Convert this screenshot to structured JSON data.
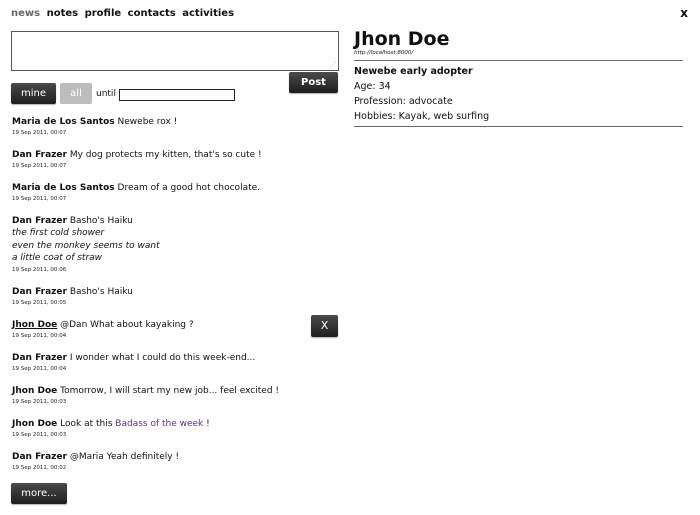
{
  "nav": {
    "items": [
      "news",
      "notes",
      "profile",
      "contacts",
      "activities"
    ],
    "close_label": "x"
  },
  "composer": {
    "value": "",
    "post_label": "Post"
  },
  "filters": {
    "mine_label": "mine",
    "all_label": "all",
    "until_label": "until",
    "until_value": ""
  },
  "feed": [
    {
      "author": "Maria de Los Santos",
      "text": "Newebe rox !",
      "time": "19 Sep 2011, 00:07"
    },
    {
      "author": "Dan Frazer",
      "text": "My dog protects my kitten, that's so cute !",
      "time": "19 Sep 2011, 00:07"
    },
    {
      "author": "Maria de Los Santos",
      "text": "Dream of a good hot chocolate.",
      "time": "19 Sep 2011, 00:07"
    },
    {
      "author": "Dan Frazer",
      "text": "Basho's Haiku",
      "verses": [
        "the first cold shower",
        "even the monkey seems to want",
        "a little coat of straw"
      ],
      "time": "19 Sep 2011, 00:06"
    },
    {
      "author": "Dan Frazer",
      "text": "Basho's Haiku",
      "time": "19 Sep 2011, 00:05"
    },
    {
      "author": "Jhon Doe",
      "text": "@Dan What about kayaking ?",
      "time": "19 Sep 2011, 00:04",
      "delete_label": "X"
    },
    {
      "author": "Dan Frazer",
      "text": "I wonder what I could do this week-end...",
      "time": "19 Sep 2011, 00:04"
    },
    {
      "author": "Jhon Doe",
      "text": "Tomorrow, I will start my new job... feel excited !",
      "time": "19 Sep 2011, 00:03"
    },
    {
      "author": "Jhon Doe",
      "text": "Look at this",
      "link_text": "Badass of the week",
      "text_after": "!",
      "time": "19 Sep 2011, 00:03"
    },
    {
      "author": "Dan Frazer",
      "text": "@Maria Yeah definitely !",
      "time": "19 Sep 2011, 00:02"
    }
  ],
  "more_label": "more...",
  "profile": {
    "name": "Jhon Doe",
    "url": "http://localhost:8000/",
    "tagline": "Newebe early adopter",
    "age": "Age: 34",
    "profession": "Profession: advocate",
    "hobbies": "Hobbies: Kayak, web surfing"
  },
  "colors": {
    "button_dark": "#2a2a2a",
    "button_disabled": "#bcbcbc",
    "link": "#553388"
  }
}
